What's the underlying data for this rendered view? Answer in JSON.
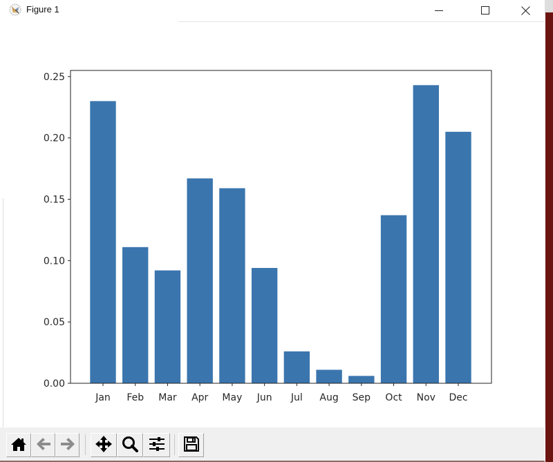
{
  "window": {
    "title": "Figure 1",
    "icon": "matplotlib-icon",
    "controls": {
      "minimize": "minimize-icon",
      "maximize": "maximize-icon",
      "close": "close-icon"
    }
  },
  "toolbar": {
    "buttons": [
      {
        "name": "home-button",
        "icon": "home-icon",
        "enabled": true
      },
      {
        "name": "back-button",
        "icon": "arrow-left-icon",
        "enabled": false
      },
      {
        "name": "forward-button",
        "icon": "arrow-right-icon",
        "enabled": false
      },
      {
        "name": "pan-button",
        "icon": "move-icon",
        "enabled": true
      },
      {
        "name": "zoom-button",
        "icon": "magnifier-icon",
        "enabled": true
      },
      {
        "name": "configure-subplots-button",
        "icon": "sliders-icon",
        "enabled": true
      },
      {
        "name": "save-button",
        "icon": "floppy-disk-icon",
        "enabled": true
      }
    ]
  },
  "colors": {
    "bar": "#3a75ae",
    "axis": "#222222",
    "tick_label": "#262626"
  },
  "chart_data": {
    "type": "bar",
    "title": "",
    "xlabel": "",
    "ylabel": "",
    "categories": [
      "Jan",
      "Feb",
      "Mar",
      "Apr",
      "May",
      "Jun",
      "Jul",
      "Aug",
      "Sep",
      "Oct",
      "Nov",
      "Dec"
    ],
    "values": [
      0.23,
      0.111,
      0.092,
      0.167,
      0.159,
      0.094,
      0.026,
      0.011,
      0.006,
      0.137,
      0.243,
      0.205
    ],
    "ylim": [
      0,
      0.255
    ],
    "yticks": [
      0.0,
      0.05,
      0.1,
      0.15,
      0.2,
      0.25
    ],
    "ytick_labels": [
      "0.00",
      "0.05",
      "0.10",
      "0.15",
      "0.20",
      "0.25"
    ],
    "grid": false,
    "legend": "none"
  }
}
